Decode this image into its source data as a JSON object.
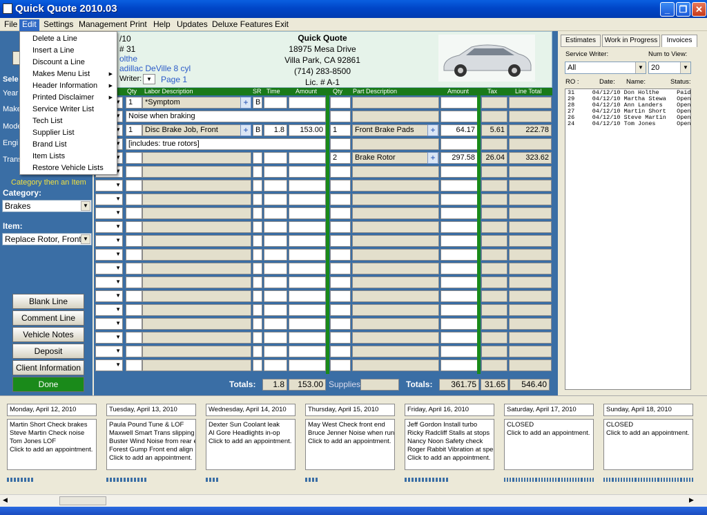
{
  "window": {
    "title": "Quick Quote 2010.03"
  },
  "menubar": [
    "File",
    "Edit",
    "Settings",
    "Management",
    "Print",
    "Help",
    "Updates",
    "Deluxe Features",
    "Exit"
  ],
  "edit_menu": [
    {
      "label": "Delete a Line",
      "sub": false
    },
    {
      "label": "Insert a Line",
      "sub": false
    },
    {
      "label": "Discount a Line",
      "sub": false
    },
    {
      "label": "Makes Menu List",
      "sub": true
    },
    {
      "label": "Header Information",
      "sub": true
    },
    {
      "label": "Printed Disclaimer",
      "sub": true
    },
    {
      "label": "Service Writer List",
      "sub": false
    },
    {
      "label": "Tech List",
      "sub": false
    },
    {
      "label": "Supplier List",
      "sub": false
    },
    {
      "label": "Brand List",
      "sub": false
    },
    {
      "label": "Item Lists",
      "sub": false
    },
    {
      "label": "Restore Vehicle Lists",
      "sub": false
    }
  ],
  "left": {
    "partial_labels": [
      "Sele",
      "Year",
      "Make",
      "Mode",
      "Engi",
      "Trans"
    ],
    "hint": "Category then an Item",
    "category_label": "Category:",
    "category_value": "Brakes",
    "item_label": "Item:",
    "item_value": "Replace Rotor, Front",
    "buttons": [
      "Blank Line",
      "Comment Line",
      "Vehicle Notes",
      "Deposit",
      "Client Information",
      "Done"
    ]
  },
  "header": {
    "date_partial": "/10",
    "ro_partial": "# 31",
    "name_partial": "olthe",
    "vehicle_partial": "adillac DeVille 8 cyl",
    "writer_label": "Writer:",
    "page": "Page 1",
    "shop_name": "Quick Quote",
    "address1": "18975 Mesa Drive",
    "address2": "Villa Park, CA 92861",
    "phone": "(714) 283-8500",
    "license": "Lic. # A-1"
  },
  "grid_headers": {
    "qty": "Qty",
    "labor": "Labor Description",
    "sr": "SR",
    "time": "Time",
    "amount": "Amount",
    "pqty": "Qty",
    "part": "Part Description",
    "pamount": "Amount",
    "tax": "Tax",
    "total": "Line Total"
  },
  "rows": [
    {
      "qty": "1",
      "labor": "*Symptom",
      "sr": "B",
      "plus": true
    },
    {
      "comment": "Noise when braking"
    },
    {
      "qty": "1",
      "labor": "Disc Brake Job, Front",
      "sr": "B",
      "time": "1.8",
      "amount": "153.00",
      "pqty": "1",
      "part": "Front Brake Pads",
      "pamount": "64.17",
      "tax": "5.61",
      "total": "222.78",
      "plus": true,
      "pplus": true
    },
    {
      "comment": "[includes: true rotors]"
    },
    {
      "pqty": "2",
      "part": "Brake Rotor",
      "pamount": "297.58",
      "tax": "26.04",
      "total": "323.62",
      "pplus": true
    }
  ],
  "totals": {
    "label": "Totals:",
    "time": "1.8",
    "labor": "153.00",
    "supplies_label": "Supplies:",
    "label2": "Totals:",
    "parts": "361.75",
    "tax": "31.65",
    "total": "546.40"
  },
  "right": {
    "tabs": [
      "Estimates",
      "Work in Progress",
      "Invoices"
    ],
    "writer_label": "Service Writer:",
    "num_label": "Num to View:",
    "writer_value": "All",
    "num_value": "20",
    "cols": [
      "RO :",
      "Date:",
      "Name:",
      "Status:"
    ],
    "ros": [
      "31     04/12/10 Don Holthe     Paid",
      "29     04/12/10 Martha Stewa   Open",
      "28     04/12/10 Ann Landers    Open",
      "27     04/12/10 Martin Short   Open",
      "26     04/12/10 Steve Martin   Open",
      "24     04/12/10 Tom Jones      Open"
    ]
  },
  "calendar": [
    {
      "date": "Monday, April 12, 2010",
      "lines": [
        "Martin Short Check brakes",
        "Steve Martin Check noise",
        "Tom Jones LOF",
        "Click to add an appointment."
      ],
      "bars": 8
    },
    {
      "date": "Tuesday, April 13, 2010",
      "lines": [
        "Paula Pound Tune & LOF",
        "Maxwell Smart Trans slipping",
        "Buster Wind Noise from rear er",
        "Forest Gump Front end align",
        "Click to add an appointment."
      ],
      "bars": 12
    },
    {
      "date": "Wednesday, April 14, 2010",
      "lines": [
        "Dexter Sun Coolant leak",
        "Al Gore Headlights in-op",
        "Click to add an appointment."
      ],
      "bars": 4
    },
    {
      "date": "Thursday, April 15, 2010",
      "lines": [
        "May West Check front end",
        "Bruce Jenner Noise when runn",
        "Click to add an appointment."
      ],
      "bars": 4
    },
    {
      "date": "Friday, April 16, 2010",
      "lines": [
        "Jeff Gordon Install turbo",
        "Ricky Radcliff Stalls at stops",
        "Nancy Noon Safety check",
        "Roger Rabbit Vibration at spee",
        "Click to add an appointment."
      ],
      "bars": 13
    },
    {
      "date": "Saturday, April 17, 2010",
      "lines": [
        "CLOSED",
        "Click to add an appointment."
      ],
      "bars": 32
    },
    {
      "date": "Sunday, April 18, 2010",
      "lines": [
        "CLOSED",
        "Click to add an appointment."
      ],
      "bars": 32
    }
  ]
}
